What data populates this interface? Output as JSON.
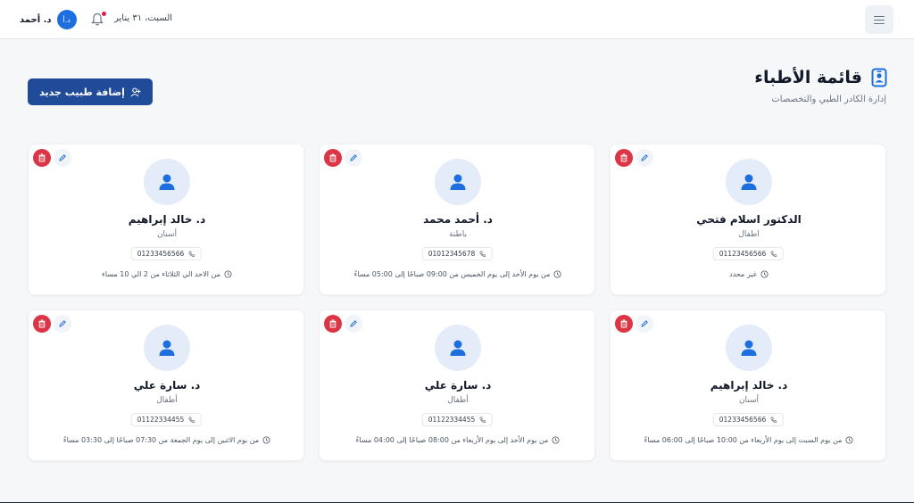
{
  "topbar": {
    "user_name": "د. أحمد",
    "avatar_initials": "د.أ",
    "date": "السبت، ٣١ يناير"
  },
  "header": {
    "title": "قائمة الأطباء",
    "subtitle": "إدارة الكادر الطبي والتخصصات",
    "add_button_label": "إضافة طبيب جديد"
  },
  "colors": {
    "primary": "#1f4b99",
    "accent": "#1d6fe0",
    "danger": "#dc3545",
    "avatar_bg": "#e3ecf8"
  },
  "doctors": [
    {
      "name": "الدكتور اسلام فتحي",
      "specialty": "اطفال",
      "phone": "01123456566",
      "hours": "غير محدد"
    },
    {
      "name": "د. أحمد محمد",
      "specialty": "باطنة",
      "phone": "01012345678",
      "hours": "من يوم الأحد إلى يوم الخميس من 09:00 صباحًا إلى 05:00 مساءً"
    },
    {
      "name": "د. خالد إبراهيم",
      "specialty": "أسنان",
      "phone": "01233456566",
      "hours": "من الاحد الي الثلاثاء من 2 الي 10 مساء"
    },
    {
      "name": "د. خالد إبراهيم",
      "specialty": "أسنان",
      "phone": "01233456566",
      "hours": "من يوم السبت إلى يوم الأربعاء من 10:00 صباحًا إلى 06:00 مساءً"
    },
    {
      "name": "د. سارة علي",
      "specialty": "أطفال",
      "phone": "01122334455",
      "hours": "من يوم الأحد إلى يوم الأربعاء من 08:00 صباحًا إلى 04:00 مساءً"
    },
    {
      "name": "د. سارة علي",
      "specialty": "أطفال",
      "phone": "01122334455",
      "hours": "من يوم الاثنين إلى يوم الجمعة من 07:30 صباحًا إلى 03:30 مساءً"
    }
  ]
}
